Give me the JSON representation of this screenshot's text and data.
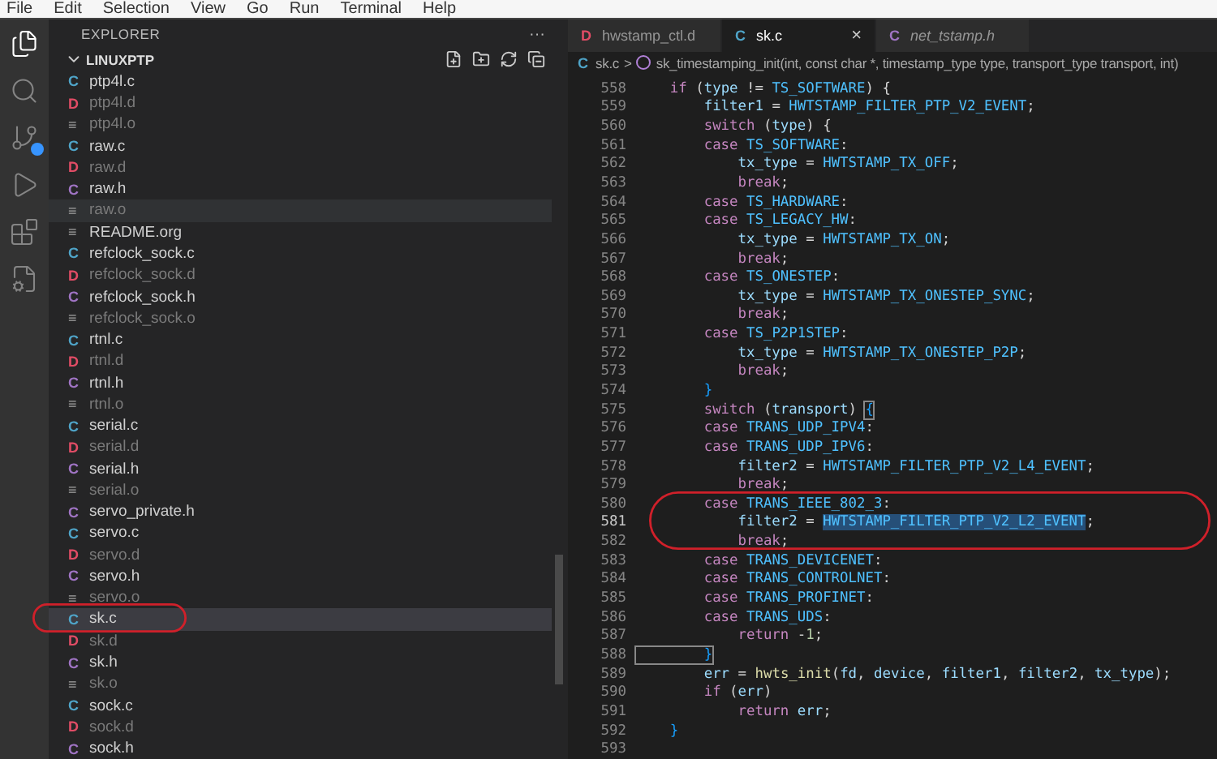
{
  "menu": [
    "File",
    "Edit",
    "Selection",
    "View",
    "Go",
    "Run",
    "Terminal",
    "Help"
  ],
  "sidebar": {
    "title": "EXPLORER",
    "more": "···",
    "folder": {
      "name": "LINUXPTP",
      "expanded": true
    },
    "files": [
      {
        "icon": "C",
        "kind": "c",
        "name": "ptp4l.c",
        "dimmed": false,
        "selected": false,
        "hovered": false
      },
      {
        "icon": "D",
        "kind": "d",
        "name": "ptp4l.d",
        "dimmed": true,
        "selected": false,
        "hovered": false
      },
      {
        "icon": "≡",
        "kind": "o",
        "name": "ptp4l.o",
        "dimmed": true,
        "selected": false,
        "hovered": false
      },
      {
        "icon": "C",
        "kind": "c",
        "name": "raw.c",
        "dimmed": false,
        "selected": false,
        "hovered": false
      },
      {
        "icon": "D",
        "kind": "d",
        "name": "raw.d",
        "dimmed": true,
        "selected": false,
        "hovered": false
      },
      {
        "icon": "C",
        "kind": "h",
        "name": "raw.h",
        "dimmed": false,
        "selected": false,
        "hovered": false
      },
      {
        "icon": "≡",
        "kind": "o",
        "name": "raw.o",
        "dimmed": true,
        "selected": false,
        "hovered": true
      },
      {
        "icon": "≡",
        "kind": "org",
        "name": "README.org",
        "dimmed": false,
        "selected": false,
        "hovered": false
      },
      {
        "icon": "C",
        "kind": "c",
        "name": "refclock_sock.c",
        "dimmed": false,
        "selected": false,
        "hovered": false
      },
      {
        "icon": "D",
        "kind": "d",
        "name": "refclock_sock.d",
        "dimmed": true,
        "selected": false,
        "hovered": false
      },
      {
        "icon": "C",
        "kind": "h",
        "name": "refclock_sock.h",
        "dimmed": false,
        "selected": false,
        "hovered": false
      },
      {
        "icon": "≡",
        "kind": "o",
        "name": "refclock_sock.o",
        "dimmed": true,
        "selected": false,
        "hovered": false
      },
      {
        "icon": "C",
        "kind": "c",
        "name": "rtnl.c",
        "dimmed": false,
        "selected": false,
        "hovered": false
      },
      {
        "icon": "D",
        "kind": "d",
        "name": "rtnl.d",
        "dimmed": true,
        "selected": false,
        "hovered": false
      },
      {
        "icon": "C",
        "kind": "h",
        "name": "rtnl.h",
        "dimmed": false,
        "selected": false,
        "hovered": false
      },
      {
        "icon": "≡",
        "kind": "o",
        "name": "rtnl.o",
        "dimmed": true,
        "selected": false,
        "hovered": false
      },
      {
        "icon": "C",
        "kind": "c",
        "name": "serial.c",
        "dimmed": false,
        "selected": false,
        "hovered": false
      },
      {
        "icon": "D",
        "kind": "d",
        "name": "serial.d",
        "dimmed": true,
        "selected": false,
        "hovered": false
      },
      {
        "icon": "C",
        "kind": "h",
        "name": "serial.h",
        "dimmed": false,
        "selected": false,
        "hovered": false
      },
      {
        "icon": "≡",
        "kind": "o",
        "name": "serial.o",
        "dimmed": true,
        "selected": false,
        "hovered": false
      },
      {
        "icon": "C",
        "kind": "h",
        "name": "servo_private.h",
        "dimmed": false,
        "selected": false,
        "hovered": false
      },
      {
        "icon": "C",
        "kind": "c",
        "name": "servo.c",
        "dimmed": false,
        "selected": false,
        "hovered": false
      },
      {
        "icon": "D",
        "kind": "d",
        "name": "servo.d",
        "dimmed": true,
        "selected": false,
        "hovered": false
      },
      {
        "icon": "C",
        "kind": "h",
        "name": "servo.h",
        "dimmed": false,
        "selected": false,
        "hovered": false
      },
      {
        "icon": "≡",
        "kind": "o",
        "name": "servo.o",
        "dimmed": true,
        "selected": false,
        "hovered": false
      },
      {
        "icon": "C",
        "kind": "c",
        "name": "sk.c",
        "dimmed": false,
        "selected": true,
        "hovered": false
      },
      {
        "icon": "D",
        "kind": "d",
        "name": "sk.d",
        "dimmed": true,
        "selected": false,
        "hovered": false
      },
      {
        "icon": "C",
        "kind": "h",
        "name": "sk.h",
        "dimmed": false,
        "selected": false,
        "hovered": false
      },
      {
        "icon": "≡",
        "kind": "o",
        "name": "sk.o",
        "dimmed": true,
        "selected": false,
        "hovered": false
      },
      {
        "icon": "C",
        "kind": "c",
        "name": "sock.c",
        "dimmed": false,
        "selected": false,
        "hovered": false
      },
      {
        "icon": "D",
        "kind": "d",
        "name": "sock.d",
        "dimmed": true,
        "selected": false,
        "hovered": false
      },
      {
        "icon": "C",
        "kind": "h",
        "name": "sock.h",
        "dimmed": false,
        "selected": false,
        "hovered": false
      }
    ]
  },
  "tabs": [
    {
      "icon": "D",
      "kind": "d",
      "label": "hwstamp_ctl.d",
      "selected": false,
      "preview": false
    },
    {
      "icon": "C",
      "kind": "c",
      "label": "sk.c",
      "selected": true,
      "preview": false,
      "close": "×"
    },
    {
      "icon": "C",
      "kind": "h",
      "label": "net_tstamp.h",
      "selected": false,
      "preview": true
    }
  ],
  "breadcrumb": {
    "icon": "C",
    "file": "sk.c",
    "separator": ">",
    "symbol": "sk_timestamping_init(int, const char *, timestamp_type type, transport_type transport, int)"
  },
  "code": [
    {
      "number": "558",
      "current": false,
      "tokens": [
        {
          "kind": "kw",
          "text": "    if"
        },
        {
          "kind": "plain",
          "text": " ("
        },
        {
          "kind": "var",
          "text": "type"
        },
        {
          "kind": "plain",
          "text": " != "
        },
        {
          "kind": "const",
          "text": "TS_SOFTWARE"
        },
        {
          "kind": "plain",
          "text": ") {"
        }
      ]
    },
    {
      "number": "559",
      "current": false,
      "tokens": [
        {
          "kind": "var",
          "text": "        filter1"
        },
        {
          "kind": "plain",
          "text": " = "
        },
        {
          "kind": "const",
          "text": "HWTSTAMP_FILTER_PTP_V2_EVENT"
        },
        {
          "kind": "plain",
          "text": ";"
        }
      ]
    },
    {
      "number": "560",
      "current": false,
      "tokens": [
        {
          "kind": "kw",
          "text": "        switch"
        },
        {
          "kind": "plain",
          "text": " ("
        },
        {
          "kind": "var",
          "text": "type"
        },
        {
          "kind": "plain",
          "text": ") {"
        }
      ]
    },
    {
      "number": "561",
      "current": false,
      "tokens": [
        {
          "kind": "kw",
          "text": "        case "
        },
        {
          "kind": "const",
          "text": "TS_SOFTWARE"
        },
        {
          "kind": "plain",
          "text": ":"
        }
      ]
    },
    {
      "number": "562",
      "current": false,
      "tokens": [
        {
          "kind": "var",
          "text": "            tx_type"
        },
        {
          "kind": "plain",
          "text": " = "
        },
        {
          "kind": "const",
          "text": "HWTSTAMP_TX_OFF"
        },
        {
          "kind": "plain",
          "text": ";"
        }
      ]
    },
    {
      "number": "563",
      "current": false,
      "tokens": [
        {
          "kind": "kw",
          "text": "            break"
        },
        {
          "kind": "plain",
          "text": ";"
        }
      ]
    },
    {
      "number": "564",
      "current": false,
      "tokens": [
        {
          "kind": "kw",
          "text": "        case "
        },
        {
          "kind": "const",
          "text": "TS_HARDWARE"
        },
        {
          "kind": "plain",
          "text": ":"
        }
      ]
    },
    {
      "number": "565",
      "current": false,
      "tokens": [
        {
          "kind": "kw",
          "text": "        case "
        },
        {
          "kind": "const",
          "text": "TS_LEGACY_HW"
        },
        {
          "kind": "plain",
          "text": ":"
        }
      ]
    },
    {
      "number": "566",
      "current": false,
      "tokens": [
        {
          "kind": "var",
          "text": "            tx_type"
        },
        {
          "kind": "plain",
          "text": " = "
        },
        {
          "kind": "const",
          "text": "HWTSTAMP_TX_ON"
        },
        {
          "kind": "plain",
          "text": ";"
        }
      ]
    },
    {
      "number": "567",
      "current": false,
      "tokens": [
        {
          "kind": "kw",
          "text": "            break"
        },
        {
          "kind": "plain",
          "text": ";"
        }
      ]
    },
    {
      "number": "568",
      "current": false,
      "tokens": [
        {
          "kind": "kw",
          "text": "        case "
        },
        {
          "kind": "const",
          "text": "TS_ONESTEP"
        },
        {
          "kind": "plain",
          "text": ":"
        }
      ]
    },
    {
      "number": "569",
      "current": false,
      "tokens": [
        {
          "kind": "var",
          "text": "            tx_type"
        },
        {
          "kind": "plain",
          "text": " = "
        },
        {
          "kind": "const",
          "text": "HWTSTAMP_TX_ONESTEP_SYNC"
        },
        {
          "kind": "plain",
          "text": ";"
        }
      ]
    },
    {
      "number": "570",
      "current": false,
      "tokens": [
        {
          "kind": "kw",
          "text": "            break"
        },
        {
          "kind": "plain",
          "text": ";"
        }
      ]
    },
    {
      "number": "571",
      "current": false,
      "tokens": [
        {
          "kind": "kw",
          "text": "        case "
        },
        {
          "kind": "const",
          "text": "TS_P2P1STEP"
        },
        {
          "kind": "plain",
          "text": ":"
        }
      ]
    },
    {
      "number": "572",
      "current": false,
      "tokens": [
        {
          "kind": "var",
          "text": "            tx_type"
        },
        {
          "kind": "plain",
          "text": " = "
        },
        {
          "kind": "const",
          "text": "HWTSTAMP_TX_ONESTEP_P2P"
        },
        {
          "kind": "plain",
          "text": ";"
        }
      ]
    },
    {
      "number": "573",
      "current": false,
      "tokens": [
        {
          "kind": "kw",
          "text": "            break"
        },
        {
          "kind": "plain",
          "text": ";"
        }
      ]
    },
    {
      "number": "574",
      "current": false,
      "tokens": [
        {
          "kind": "brace",
          "text": "        }"
        }
      ]
    },
    {
      "number": "575",
      "current": false,
      "tokens": [
        {
          "kind": "kw",
          "text": "        switch"
        },
        {
          "kind": "plain",
          "text": " ("
        },
        {
          "kind": "var",
          "text": "transport"
        },
        {
          "kind": "plain",
          "text": ") "
        },
        {
          "kind": "match",
          "text": "{"
        }
      ]
    },
    {
      "number": "576",
      "current": false,
      "tokens": [
        {
          "kind": "kw",
          "text": "        case "
        },
        {
          "kind": "const",
          "text": "TRANS_UDP_IPV4"
        },
        {
          "kind": "plain",
          "text": ":"
        }
      ]
    },
    {
      "number": "577",
      "current": false,
      "tokens": [
        {
          "kind": "kw",
          "text": "        case "
        },
        {
          "kind": "const",
          "text": "TRANS_UDP_IPV6"
        },
        {
          "kind": "plain",
          "text": ":"
        }
      ]
    },
    {
      "number": "578",
      "current": false,
      "tokens": [
        {
          "kind": "var",
          "text": "            filter2"
        },
        {
          "kind": "plain",
          "text": " = "
        },
        {
          "kind": "const",
          "text": "HWTSTAMP_FILTER_PTP_V2_L4_EVENT"
        },
        {
          "kind": "plain",
          "text": ";"
        }
      ]
    },
    {
      "number": "579",
      "current": false,
      "tokens": [
        {
          "kind": "kw",
          "text": "            break"
        },
        {
          "kind": "plain",
          "text": ";"
        }
      ]
    },
    {
      "number": "580",
      "current": false,
      "tokens": [
        {
          "kind": "kw",
          "text": "        case "
        },
        {
          "kind": "const",
          "text": "TRANS_IEEE_802_3"
        },
        {
          "kind": "plain",
          "text": ":"
        }
      ]
    },
    {
      "number": "581",
      "current": true,
      "tokens": [
        {
          "kind": "var",
          "text": "            filter2"
        },
        {
          "kind": "plain",
          "text": " = "
        },
        {
          "kind": "selected",
          "text": "HWTSTAMP_FILTER_PTP_V2_L2_EVENT"
        },
        {
          "kind": "plain",
          "text": ";"
        }
      ]
    },
    {
      "number": "582",
      "current": false,
      "tokens": [
        {
          "kind": "kw",
          "text": "            break"
        },
        {
          "kind": "plain",
          "text": ";"
        }
      ]
    },
    {
      "number": "583",
      "current": false,
      "tokens": [
        {
          "kind": "kw",
          "text": "        case "
        },
        {
          "kind": "const",
          "text": "TRANS_DEVICENET"
        },
        {
          "kind": "plain",
          "text": ":"
        }
      ]
    },
    {
      "number": "584",
      "current": false,
      "tokens": [
        {
          "kind": "kw",
          "text": "        case "
        },
        {
          "kind": "const",
          "text": "TRANS_CONTROLNET"
        },
        {
          "kind": "plain",
          "text": ":"
        }
      ]
    },
    {
      "number": "585",
      "current": false,
      "tokens": [
        {
          "kind": "kw",
          "text": "        case "
        },
        {
          "kind": "const",
          "text": "TRANS_PROFINET"
        },
        {
          "kind": "plain",
          "text": ":"
        }
      ]
    },
    {
      "number": "586",
      "current": false,
      "tokens": [
        {
          "kind": "kw",
          "text": "        case "
        },
        {
          "kind": "const",
          "text": "TRANS_UDS"
        },
        {
          "kind": "plain",
          "text": ":"
        }
      ]
    },
    {
      "number": "587",
      "current": false,
      "tokens": [
        {
          "kind": "kw",
          "text": "            return"
        },
        {
          "kind": "plain",
          "text": " -"
        },
        {
          "kind": "num",
          "text": "1"
        },
        {
          "kind": "plain",
          "text": ";"
        }
      ]
    },
    {
      "number": "588",
      "current": false,
      "tokens": [
        {
          "kind": "match",
          "text": "        }"
        }
      ]
    },
    {
      "number": "589",
      "current": false,
      "tokens": [
        {
          "kind": "var",
          "text": "        err"
        },
        {
          "kind": "plain",
          "text": " = "
        },
        {
          "kind": "fn",
          "text": "hwts_init"
        },
        {
          "kind": "plain",
          "text": "("
        },
        {
          "kind": "var",
          "text": "fd"
        },
        {
          "kind": "plain",
          "text": ", "
        },
        {
          "kind": "var",
          "text": "device"
        },
        {
          "kind": "plain",
          "text": ", "
        },
        {
          "kind": "var",
          "text": "filter1"
        },
        {
          "kind": "plain",
          "text": ", "
        },
        {
          "kind": "var",
          "text": "filter2"
        },
        {
          "kind": "plain",
          "text": ", "
        },
        {
          "kind": "var",
          "text": "tx_type"
        },
        {
          "kind": "plain",
          "text": ");"
        }
      ]
    },
    {
      "number": "590",
      "current": false,
      "tokens": [
        {
          "kind": "kw",
          "text": "        if"
        },
        {
          "kind": "plain",
          "text": " ("
        },
        {
          "kind": "var",
          "text": "err"
        },
        {
          "kind": "plain",
          "text": ")"
        }
      ]
    },
    {
      "number": "591",
      "current": false,
      "tokens": [
        {
          "kind": "kw",
          "text": "            return "
        },
        {
          "kind": "var",
          "text": "err"
        },
        {
          "kind": "plain",
          "text": ";"
        }
      ]
    },
    {
      "number": "592",
      "current": false,
      "tokens": [
        {
          "kind": "brace",
          "text": "    }"
        }
      ]
    },
    {
      "number": "593",
      "current": false
    }
  ]
}
